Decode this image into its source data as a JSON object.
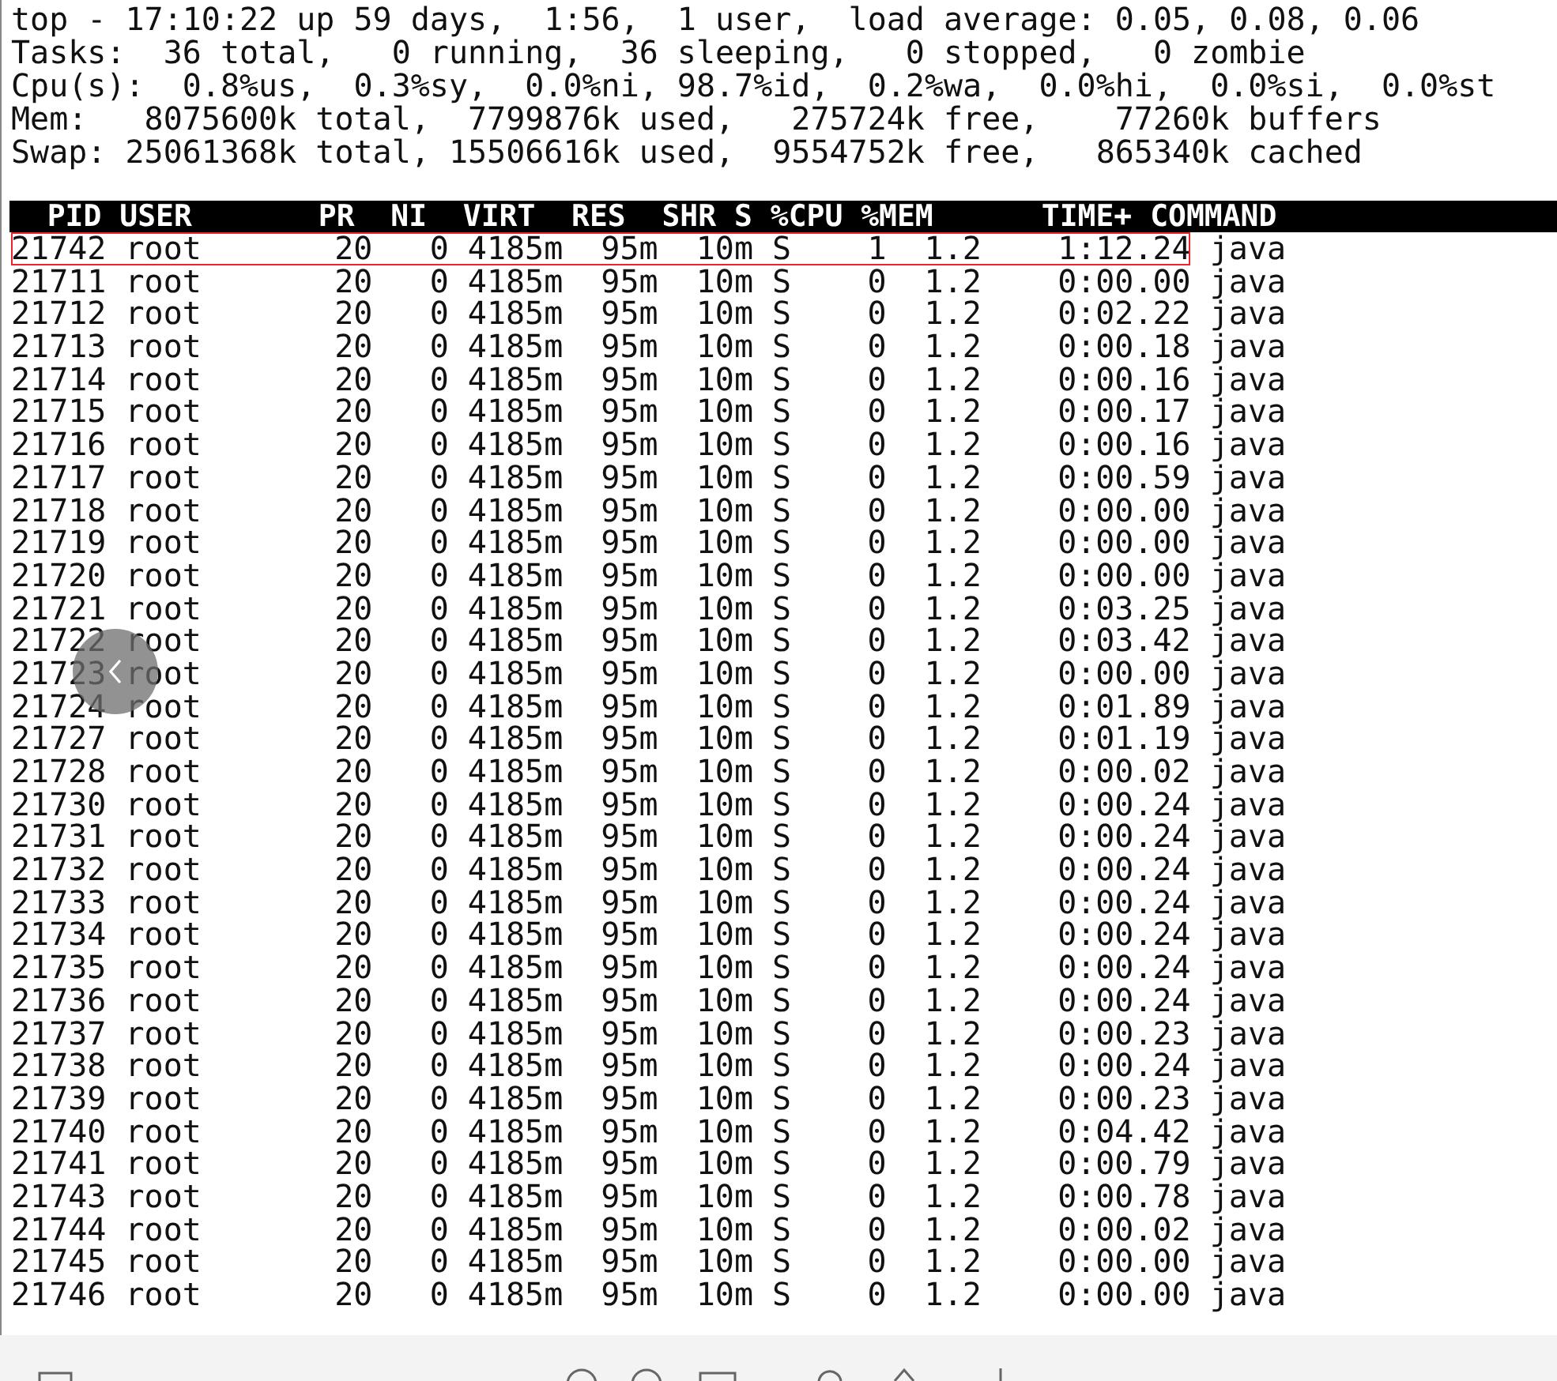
{
  "summary": [
    "top - 17:10:22 up 59 days,  1:56,  1 user,  load average: 0.05, 0.08, 0.06",
    "Tasks:  36 total,   0 running,  36 sleeping,   0 stopped,   0 zombie",
    "Cpu(s):  0.8%us,  0.3%sy,  0.0%ni, 98.7%id,  0.2%wa,  0.0%hi,  0.0%si,  0.0%st",
    "Mem:   8075600k total,  7799876k used,   275724k free,    77260k buffers",
    "Swap: 25061368k total, 15506616k used,  9554752k free,   865340k cached"
  ],
  "columns": [
    "PID",
    "USER",
    "PR",
    "NI",
    "VIRT",
    "RES",
    "SHR",
    "S",
    "%CPU",
    "%MEM",
    "TIME+",
    "COMMAND"
  ],
  "rows": [
    {
      "cells": [
        "21742",
        "root",
        "20",
        "0",
        "4185m",
        "95m",
        "10m",
        "S",
        "1",
        "1.2",
        "1:12.24",
        "java"
      ],
      "highlighted": true
    },
    {
      "cells": [
        "21711",
        "root",
        "20",
        "0",
        "4185m",
        "95m",
        "10m",
        "S",
        "0",
        "1.2",
        "0:00.00",
        "java"
      ],
      "highlighted": false
    },
    {
      "cells": [
        "21712",
        "root",
        "20",
        "0",
        "4185m",
        "95m",
        "10m",
        "S",
        "0",
        "1.2",
        "0:02.22",
        "java"
      ],
      "highlighted": false
    },
    {
      "cells": [
        "21713",
        "root",
        "20",
        "0",
        "4185m",
        "95m",
        "10m",
        "S",
        "0",
        "1.2",
        "0:00.18",
        "java"
      ],
      "highlighted": false
    },
    {
      "cells": [
        "21714",
        "root",
        "20",
        "0",
        "4185m",
        "95m",
        "10m",
        "S",
        "0",
        "1.2",
        "0:00.16",
        "java"
      ],
      "highlighted": false
    },
    {
      "cells": [
        "21715",
        "root",
        "20",
        "0",
        "4185m",
        "95m",
        "10m",
        "S",
        "0",
        "1.2",
        "0:00.17",
        "java"
      ],
      "highlighted": false
    },
    {
      "cells": [
        "21716",
        "root",
        "20",
        "0",
        "4185m",
        "95m",
        "10m",
        "S",
        "0",
        "1.2",
        "0:00.16",
        "java"
      ],
      "highlighted": false
    },
    {
      "cells": [
        "21717",
        "root",
        "20",
        "0",
        "4185m",
        "95m",
        "10m",
        "S",
        "0",
        "1.2",
        "0:00.59",
        "java"
      ],
      "highlighted": false
    },
    {
      "cells": [
        "21718",
        "root",
        "20",
        "0",
        "4185m",
        "95m",
        "10m",
        "S",
        "0",
        "1.2",
        "0:00.00",
        "java"
      ],
      "highlighted": false
    },
    {
      "cells": [
        "21719",
        "root",
        "20",
        "0",
        "4185m",
        "95m",
        "10m",
        "S",
        "0",
        "1.2",
        "0:00.00",
        "java"
      ],
      "highlighted": false
    },
    {
      "cells": [
        "21720",
        "root",
        "20",
        "0",
        "4185m",
        "95m",
        "10m",
        "S",
        "0",
        "1.2",
        "0:00.00",
        "java"
      ],
      "highlighted": false
    },
    {
      "cells": [
        "21721",
        "root",
        "20",
        "0",
        "4185m",
        "95m",
        "10m",
        "S",
        "0",
        "1.2",
        "0:03.25",
        "java"
      ],
      "highlighted": false
    },
    {
      "cells": [
        "21722",
        "root",
        "20",
        "0",
        "4185m",
        "95m",
        "10m",
        "S",
        "0",
        "1.2",
        "0:03.42",
        "java"
      ],
      "highlighted": false
    },
    {
      "cells": [
        "21723",
        "root",
        "20",
        "0",
        "4185m",
        "95m",
        "10m",
        "S",
        "0",
        "1.2",
        "0:00.00",
        "java"
      ],
      "highlighted": false
    },
    {
      "cells": [
        "21724",
        "root",
        "20",
        "0",
        "4185m",
        "95m",
        "10m",
        "S",
        "0",
        "1.2",
        "0:01.89",
        "java"
      ],
      "highlighted": false
    },
    {
      "cells": [
        "21727",
        "root",
        "20",
        "0",
        "4185m",
        "95m",
        "10m",
        "S",
        "0",
        "1.2",
        "0:01.19",
        "java"
      ],
      "highlighted": false
    },
    {
      "cells": [
        "21728",
        "root",
        "20",
        "0",
        "4185m",
        "95m",
        "10m",
        "S",
        "0",
        "1.2",
        "0:00.02",
        "java"
      ],
      "highlighted": false
    },
    {
      "cells": [
        "21730",
        "root",
        "20",
        "0",
        "4185m",
        "95m",
        "10m",
        "S",
        "0",
        "1.2",
        "0:00.24",
        "java"
      ],
      "highlighted": false
    },
    {
      "cells": [
        "21731",
        "root",
        "20",
        "0",
        "4185m",
        "95m",
        "10m",
        "S",
        "0",
        "1.2",
        "0:00.24",
        "java"
      ],
      "highlighted": false
    },
    {
      "cells": [
        "21732",
        "root",
        "20",
        "0",
        "4185m",
        "95m",
        "10m",
        "S",
        "0",
        "1.2",
        "0:00.24",
        "java"
      ],
      "highlighted": false
    },
    {
      "cells": [
        "21733",
        "root",
        "20",
        "0",
        "4185m",
        "95m",
        "10m",
        "S",
        "0",
        "1.2",
        "0:00.24",
        "java"
      ],
      "highlighted": false
    },
    {
      "cells": [
        "21734",
        "root",
        "20",
        "0",
        "4185m",
        "95m",
        "10m",
        "S",
        "0",
        "1.2",
        "0:00.24",
        "java"
      ],
      "highlighted": false
    },
    {
      "cells": [
        "21735",
        "root",
        "20",
        "0",
        "4185m",
        "95m",
        "10m",
        "S",
        "0",
        "1.2",
        "0:00.24",
        "java"
      ],
      "highlighted": false
    },
    {
      "cells": [
        "21736",
        "root",
        "20",
        "0",
        "4185m",
        "95m",
        "10m",
        "S",
        "0",
        "1.2",
        "0:00.24",
        "java"
      ],
      "highlighted": false
    },
    {
      "cells": [
        "21737",
        "root",
        "20",
        "0",
        "4185m",
        "95m",
        "10m",
        "S",
        "0",
        "1.2",
        "0:00.23",
        "java"
      ],
      "highlighted": false
    },
    {
      "cells": [
        "21738",
        "root",
        "20",
        "0",
        "4185m",
        "95m",
        "10m",
        "S",
        "0",
        "1.2",
        "0:00.24",
        "java"
      ],
      "highlighted": false
    },
    {
      "cells": [
        "21739",
        "root",
        "20",
        "0",
        "4185m",
        "95m",
        "10m",
        "S",
        "0",
        "1.2",
        "0:00.23",
        "java"
      ],
      "highlighted": false
    },
    {
      "cells": [
        "21740",
        "root",
        "20",
        "0",
        "4185m",
        "95m",
        "10m",
        "S",
        "0",
        "1.2",
        "0:04.42",
        "java"
      ],
      "highlighted": false
    },
    {
      "cells": [
        "21741",
        "root",
        "20",
        "0",
        "4185m",
        "95m",
        "10m",
        "S",
        "0",
        "1.2",
        "0:00.79",
        "java"
      ],
      "highlighted": false
    },
    {
      "cells": [
        "21743",
        "root",
        "20",
        "0",
        "4185m",
        "95m",
        "10m",
        "S",
        "0",
        "1.2",
        "0:00.78",
        "java"
      ],
      "highlighted": false
    },
    {
      "cells": [
        "21744",
        "root",
        "20",
        "0",
        "4185m",
        "95m",
        "10m",
        "S",
        "0",
        "1.2",
        "0:00.02",
        "java"
      ],
      "highlighted": false
    },
    {
      "cells": [
        "21745",
        "root",
        "20",
        "0",
        "4185m",
        "95m",
        "10m",
        "S",
        "0",
        "1.2",
        "0:00.00",
        "java"
      ],
      "highlighted": false
    },
    {
      "cells": [
        "21746",
        "root",
        "20",
        "0",
        "4185m",
        "95m",
        "10m",
        "S",
        "0",
        "1.2",
        "0:00.00",
        "java"
      ],
      "highlighted": false
    }
  ]
}
